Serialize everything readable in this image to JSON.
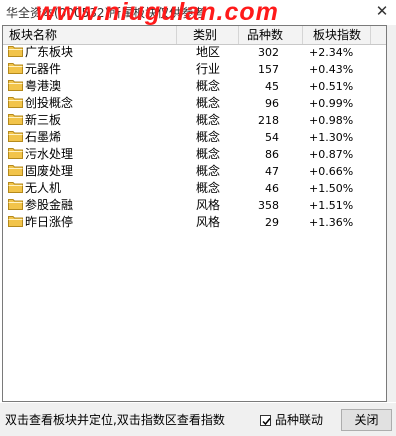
{
  "window": {
    "title": "华全资本(000532)所属板块仅供参考",
    "watermark": "www.niugulan.com"
  },
  "table": {
    "headers": [
      "板块名称",
      "类别",
      "品种数",
      "板块指数"
    ],
    "rows": [
      {
        "name": "广东板块",
        "type": "地区",
        "count": "302",
        "index": "+2.34%"
      },
      {
        "name": "元器件",
        "type": "行业",
        "count": "157",
        "index": "+0.43%"
      },
      {
        "name": "粤港澳",
        "type": "概念",
        "count": "45",
        "index": "+0.51%"
      },
      {
        "name": "创投概念",
        "type": "概念",
        "count": "96",
        "index": "+0.99%"
      },
      {
        "name": "新三板",
        "type": "概念",
        "count": "218",
        "index": "+0.98%"
      },
      {
        "name": "石墨烯",
        "type": "概念",
        "count": "54",
        "index": "+1.30%"
      },
      {
        "name": "污水处理",
        "type": "概念",
        "count": "86",
        "index": "+0.87%"
      },
      {
        "name": "固废处理",
        "type": "概念",
        "count": "47",
        "index": "+0.66%"
      },
      {
        "name": "无人机",
        "type": "概念",
        "count": "46",
        "index": "+1.50%"
      },
      {
        "name": "参股金融",
        "type": "风格",
        "count": "358",
        "index": "+1.51%"
      },
      {
        "name": "昨日涨停",
        "type": "风格",
        "count": "29",
        "index": "+1.36%"
      }
    ]
  },
  "footer": {
    "hint": "双击查看板块并定位,双击指数区查看指数",
    "checkbox_label": "品种联动",
    "checkbox_checked": true,
    "close_label": "关闭"
  },
  "colors": {
    "watermark": "#ff1a1a",
    "folder": "#f2c44a"
  },
  "icons": {
    "row_icon": "folder-icon",
    "window_close": "close-icon",
    "checkbox_mark": "checkmark-icon"
  }
}
